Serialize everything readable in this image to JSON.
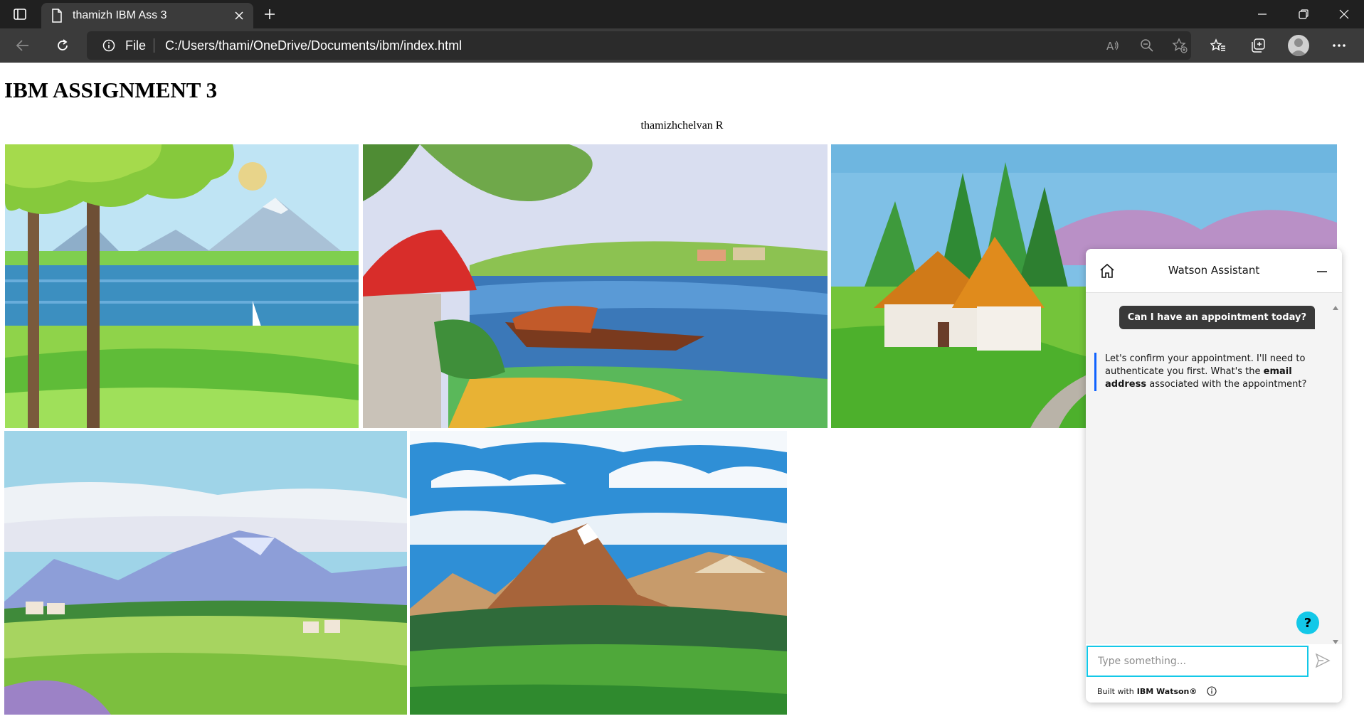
{
  "browser": {
    "tab_title": "thamizh IBM Ass 3",
    "address_scheme_label": "File",
    "url": "C:/Users/thami/OneDrive/Documents/ibm/index.html"
  },
  "page": {
    "heading": "IBM ASSIGNMENT 3",
    "author": "thamizhchelvan R"
  },
  "watson": {
    "title": "Watson Assistant",
    "user_message": "Can I have an appointment today?",
    "bot_message_part1": "Let's confirm your appointment. I'll need to authenticate you first. What's the ",
    "bot_message_bold": "email address",
    "bot_message_part2": " associated with the appointment?",
    "input_placeholder": "Type something...",
    "footer_prefix": "Built with",
    "footer_brand": "IBM Watson®",
    "help_label": "?"
  },
  "icons": {
    "tab_actions": "tab-actions-icon",
    "page": "page-icon",
    "close": "close-icon",
    "new_tab": "plus-icon",
    "back": "back-arrow-icon",
    "refresh": "refresh-icon",
    "info": "info-icon",
    "read_aloud": "read-aloud-icon",
    "zoom_out": "zoom-out-icon",
    "favorite_add": "star-plus-icon",
    "favorites": "favorites-icon",
    "collections": "collections-icon",
    "profile": "avatar-icon",
    "more": "more-icon",
    "home": "home-icon",
    "minimize": "minimize-icon",
    "send": "send-icon"
  }
}
